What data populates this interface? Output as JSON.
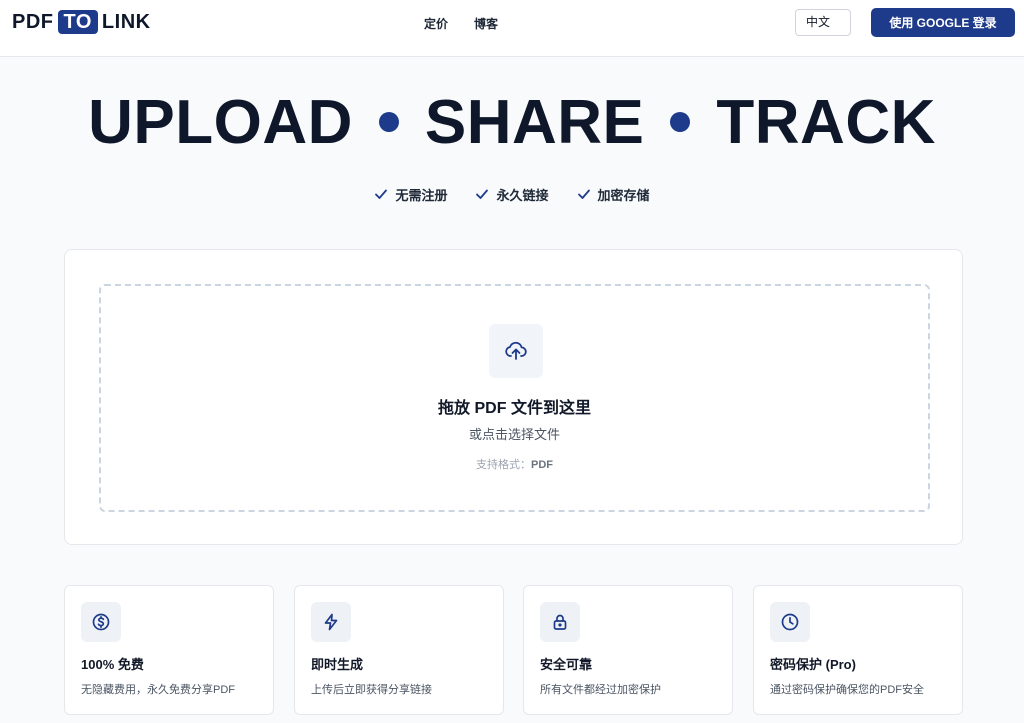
{
  "header": {
    "logo": {
      "left": "PDF",
      "middle": "TO",
      "right": "LINK"
    },
    "nav": [
      {
        "label": "定价"
      },
      {
        "label": "博客"
      }
    ],
    "language": "中文",
    "login_label": "使用 GOOGLE 登录"
  },
  "hero": {
    "words": [
      "UPLOAD",
      "SHARE",
      "TRACK"
    ],
    "checks": [
      {
        "label": "无需注册"
      },
      {
        "label": "永久链接"
      },
      {
        "label": "加密存储"
      }
    ]
  },
  "upload": {
    "icon": "cloud-upload-icon",
    "title": "拖放 PDF 文件到这里",
    "subtitle": "或点击选择文件",
    "format_label": "支持格式：",
    "format_value": "PDF"
  },
  "features": [
    {
      "icon": "dollar-icon",
      "title": "100% 免费",
      "desc": "无隐藏费用，永久免费分享PDF"
    },
    {
      "icon": "lightning-icon",
      "title": "即时生成",
      "desc": "上传后立即获得分享链接"
    },
    {
      "icon": "lock-icon",
      "title": "安全可靠",
      "desc": "所有文件都经过加密保护"
    },
    {
      "icon": "clock-icon",
      "title": "密码保护 (Pro)",
      "desc": "通过密码保护确保您的PDF安全"
    }
  ],
  "colors": {
    "brand": "#1e3a8a",
    "text": "#0f172a",
    "background": "#f8fafc"
  }
}
